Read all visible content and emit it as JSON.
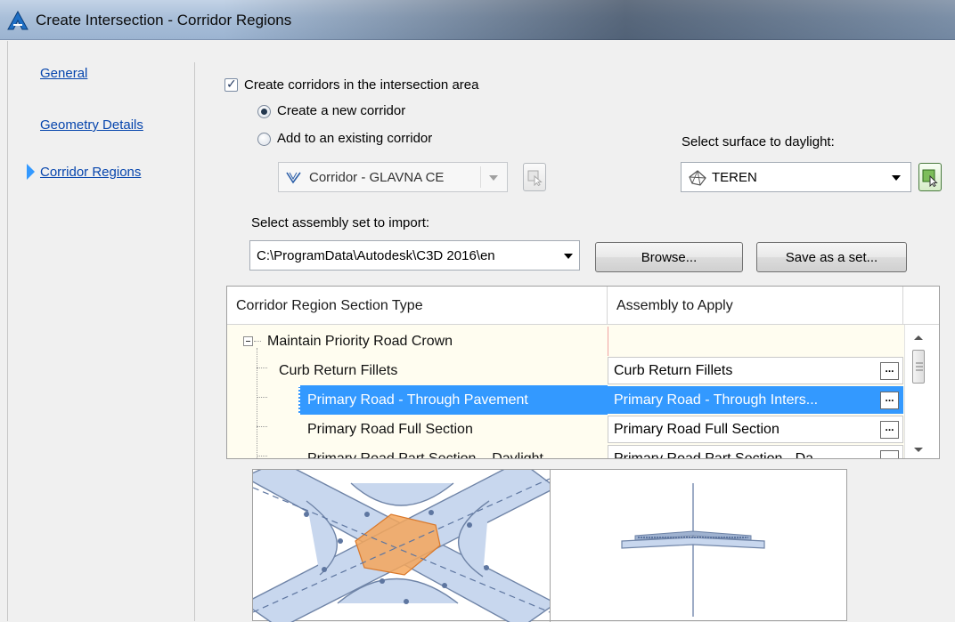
{
  "window": {
    "title": "Create Intersection - Corridor Regions",
    "icon": "autocad-a-icon"
  },
  "nav": {
    "items": [
      {
        "label": "General"
      },
      {
        "label": "Geometry Details"
      },
      {
        "label": "Corridor Regions"
      }
    ],
    "active_index": 2
  },
  "options": {
    "create_corridors_label": "Create corridors in the intersection area",
    "create_corridors_checked": true,
    "create_new_label": "Create a new corridor",
    "add_existing_label": "Add to an existing corridor",
    "selected_mode": "create_new"
  },
  "corridor_select": {
    "value": "Corridor - GLAVNA CE",
    "icon": "corridor-icon",
    "enabled": false
  },
  "surface": {
    "label": "Select surface to daylight:",
    "value": "TEREN",
    "icon": "surface-icon"
  },
  "assembly_set": {
    "label": "Select assembly set to import:",
    "value": "C:\\ProgramData\\Autodesk\\C3D 2016\\en",
    "browse_label": "Browse...",
    "save_label": "Save as a set..."
  },
  "grid": {
    "columns": [
      "Corridor Region Section Type",
      "Assembly to Apply"
    ],
    "group": "Maintain Priority Road Crown",
    "rows": [
      {
        "type": "Curb Return Fillets",
        "assembly": "Curb Return Fillets",
        "selected": false
      },
      {
        "type": "Primary Road - Through Pavement",
        "assembly": "Primary Road - Through Inters...",
        "selected": true
      },
      {
        "type": "Primary Road Full Section",
        "assembly": "Primary Road Full Section",
        "selected": false
      },
      {
        "type": "Primary Road Part Section – Daylight",
        "assembly": "Primary Road Part Section - Da",
        "selected": false
      }
    ],
    "ellipsis": "..."
  },
  "colors": {
    "accent": "#3399ff",
    "highlight_fill": "#f5a65b",
    "road_fill": "#c8d7ee",
    "link": "#0645ad"
  }
}
